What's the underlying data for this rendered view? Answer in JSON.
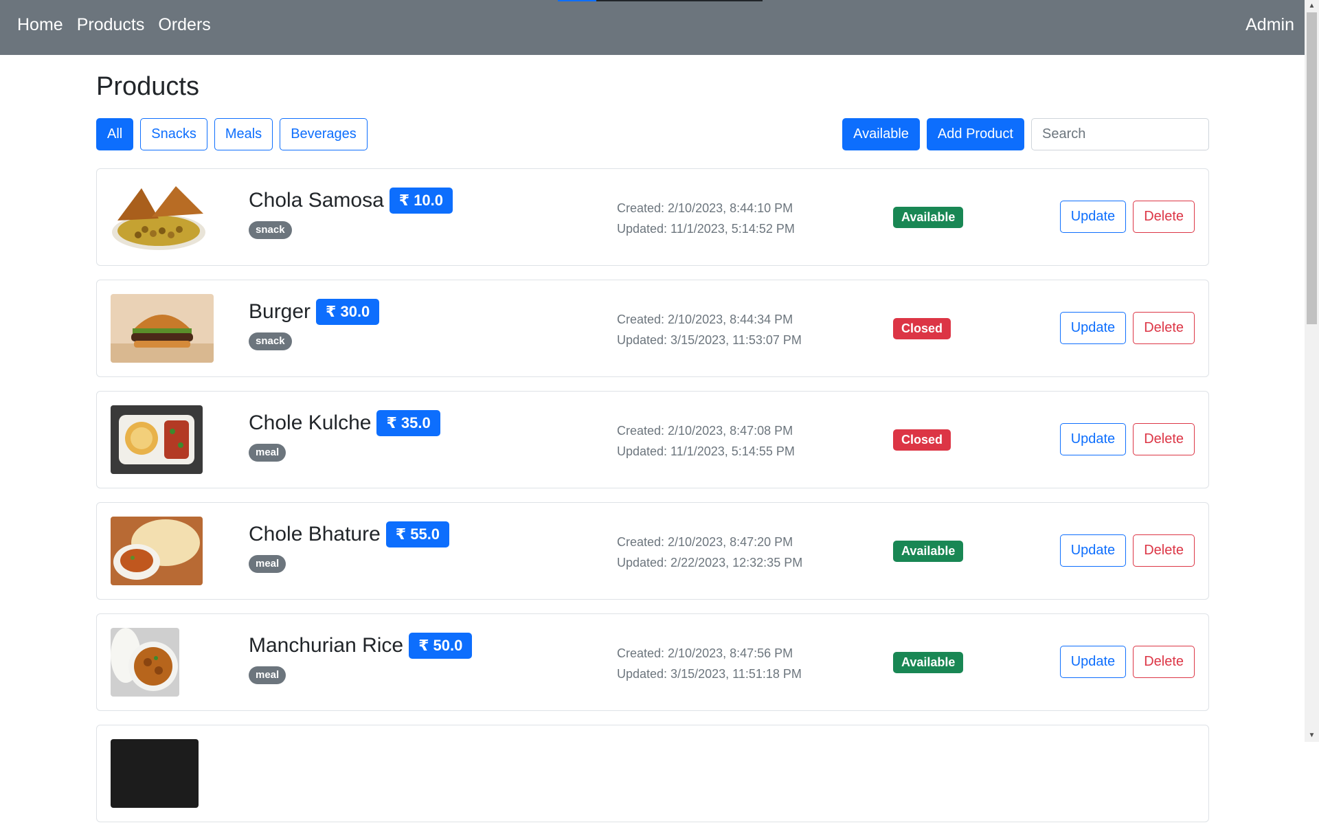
{
  "nav": {
    "links": [
      "Home",
      "Products",
      "Orders"
    ],
    "admin": "Admin"
  },
  "page": {
    "title": "Products"
  },
  "filters": [
    "All",
    "Snacks",
    "Meals",
    "Beverages"
  ],
  "toolbar": {
    "available_label": "Available",
    "add_label": "Add Product",
    "search_placeholder": "Search"
  },
  "products": [
    {
      "name": "Chola Samosa",
      "price": "₹ 10.0",
      "category": "snack",
      "created": "Created: 2/10/2023, 8:44:10 PM",
      "updated": "Updated: 11/1/2023, 5:14:52 PM",
      "status": "Available",
      "status_type": "available",
      "image": "chola-samosa",
      "update_label": "Update",
      "delete_label": "Delete"
    },
    {
      "name": "Burger",
      "price": "₹ 30.0",
      "category": "snack",
      "created": "Created: 2/10/2023, 8:44:34 PM",
      "updated": "Updated: 3/15/2023, 11:53:07 PM",
      "status": "Closed",
      "status_type": "closed",
      "image": "burger",
      "update_label": "Update",
      "delete_label": "Delete"
    },
    {
      "name": "Chole Kulche",
      "price": "₹ 35.0",
      "category": "meal",
      "created": "Created: 2/10/2023, 8:47:08 PM",
      "updated": "Updated: 11/1/2023, 5:14:55 PM",
      "status": "Closed",
      "status_type": "closed",
      "image": "chole-kulche",
      "update_label": "Update",
      "delete_label": "Delete"
    },
    {
      "name": "Chole Bhature",
      "price": "₹ 55.0",
      "category": "meal",
      "created": "Created: 2/10/2023, 8:47:20 PM",
      "updated": "Updated: 2/22/2023, 12:32:35 PM",
      "status": "Available",
      "status_type": "available",
      "image": "chole-bhature",
      "update_label": "Update",
      "delete_label": "Delete"
    },
    {
      "name": "Manchurian Rice",
      "price": "₹ 50.0",
      "category": "meal",
      "created": "Created: 2/10/2023, 8:47:56 PM",
      "updated": "Updated: 3/15/2023, 11:51:18 PM",
      "status": "Available",
      "status_type": "available",
      "image": "manchurian-rice",
      "update_label": "Update",
      "delete_label": "Delete"
    }
  ],
  "colors": {
    "navbar": "#6c757d",
    "primary": "#0d6efd",
    "success": "#198754",
    "danger": "#dc3545",
    "secondary": "#6c757d"
  }
}
